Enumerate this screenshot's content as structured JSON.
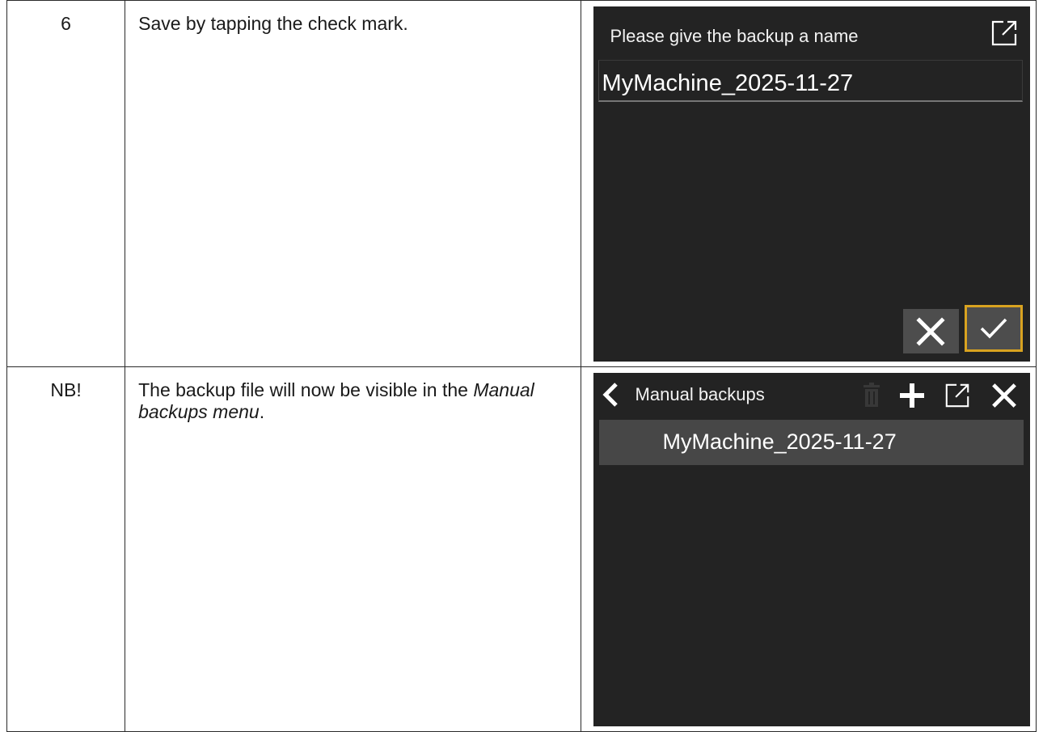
{
  "rows": [
    {
      "step": "6",
      "description": "Save by tapping the check mark."
    },
    {
      "step": "NB!",
      "description_prefix": "The backup file will now be visible in the ",
      "description_emphasis": "Manual backups menu",
      "description_suffix": "."
    }
  ],
  "dialog": {
    "title": "Please give the backup a name",
    "name_value": "MyMachine_2025-11-27",
    "icons": {
      "expand": "expand-icon",
      "cancel": "close-icon",
      "confirm": "checkmark-icon"
    }
  },
  "backups_screen": {
    "title": "Manual backups",
    "items": [
      "MyMachine_2025-11-27"
    ],
    "icons": {
      "back": "chevron-left-icon",
      "delete": "trash-icon",
      "add": "plus-icon",
      "expand": "expand-icon",
      "close": "close-icon"
    }
  },
  "colors": {
    "screen_background": "#232323",
    "button_background": "#4d4d4d",
    "highlight_border": "#d9a320",
    "list_item_background": "#474747"
  }
}
